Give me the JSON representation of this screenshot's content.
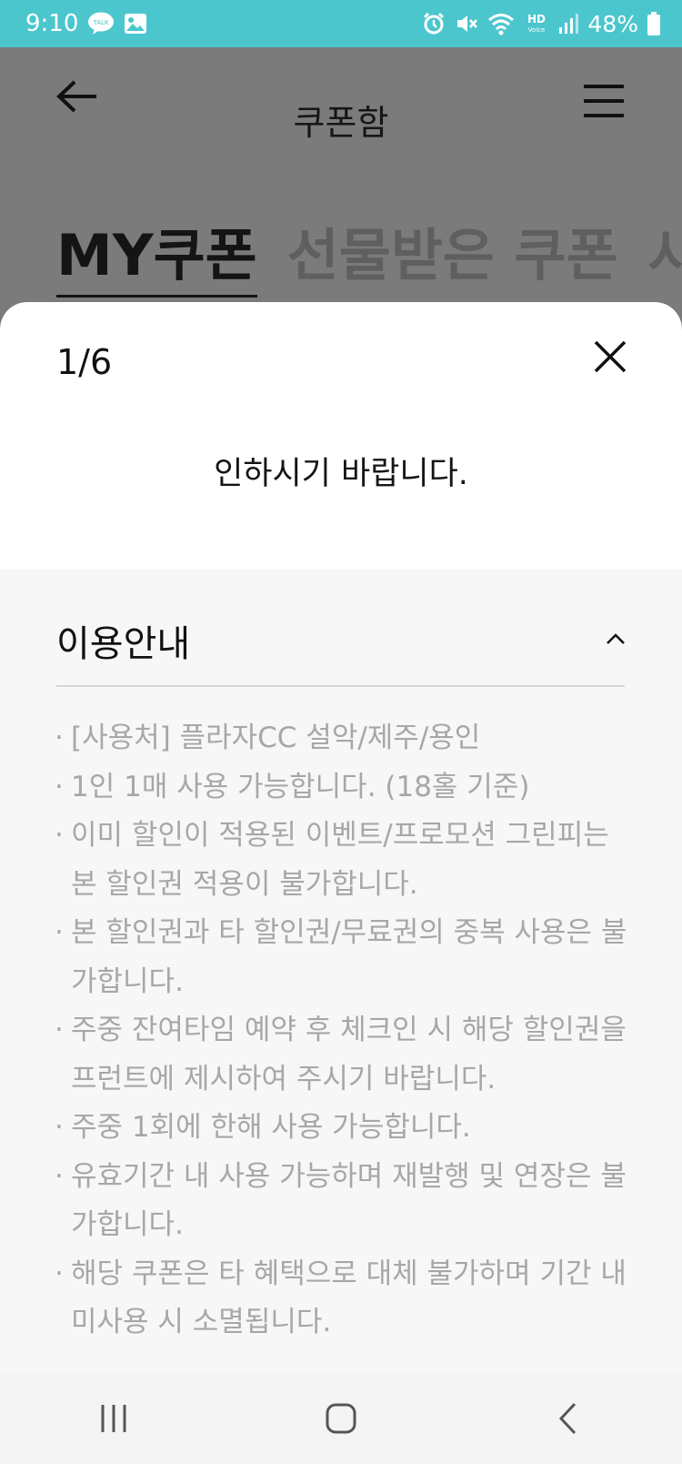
{
  "status_bar": {
    "time": "9:10",
    "battery_percent": "48%",
    "left_icons": [
      "kakaotalk-icon",
      "gallery-icon"
    ],
    "right_icons": [
      "alarm-icon",
      "mute-icon",
      "wifi-icon",
      "hd-voice-icon",
      "signal-icon",
      "battery-icon"
    ],
    "hd_label": "HD",
    "voice_label": "Voice",
    "talk_label": "TALK"
  },
  "header": {
    "title": "쿠폰함"
  },
  "tabs": [
    {
      "label": "MY쿠폰",
      "active": true
    },
    {
      "label": "선물받은 쿠폰",
      "active": false
    },
    {
      "label": "사",
      "active": false
    }
  ],
  "sheet": {
    "counter": "1/6",
    "message": "인하시기 바랍니다.",
    "info": {
      "title": "이용안내",
      "notes": [
        "[사용처] 플라자CC 설악/제주/용인",
        "1인 1매 사용 가능합니다. (18홀 기준)",
        "이미 할인이 적용된 이벤트/프로모션 그린피는 본 할인권 적용이 불가합니다.",
        "본 할인권과 타 할인권/무료권의 중복 사용은 불가합니다.",
        "주중 잔여타임 예약 후 체크인 시 해당 할인권을 프런트에 제시하여 주시기 바랍니다.",
        "주중 1회에 한해 사용 가능합니다.",
        "유효기간 내 사용 가능하며 재발행 및 연장은 불가합니다.",
        "해당 쿠폰은 타 혜택으로 대체 불가하며 기간 내 미사용 시 소멸됩니다."
      ]
    }
  },
  "colors": {
    "status_bar": "#4cc6cd",
    "overlay": "#7b7b7b",
    "info_background": "#f7f7f8",
    "note_text": "#a7a7a7"
  }
}
